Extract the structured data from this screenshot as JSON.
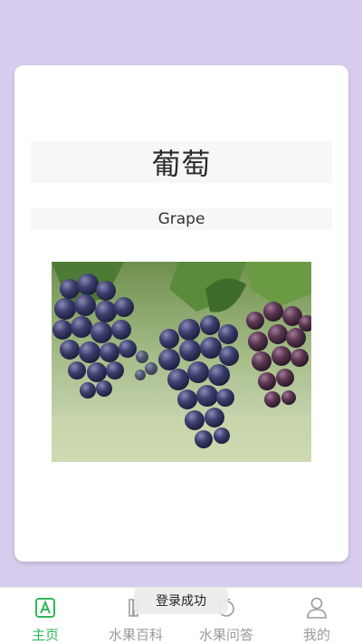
{
  "fruit": {
    "name_cn": "葡萄",
    "name_en": "Grape"
  },
  "tabbar": {
    "tabs": [
      {
        "label": "主页",
        "icon": "home-a-icon",
        "active": true
      },
      {
        "label": "水果百科",
        "icon": "book-icon",
        "active": false
      },
      {
        "label": "水果问答",
        "icon": "apple-icon",
        "active": false
      },
      {
        "label": "我的",
        "icon": "user-icon",
        "active": false
      }
    ]
  },
  "toast": {
    "text": "登录成功"
  },
  "colors": {
    "background": "#d7ccee",
    "active_tab": "#2fb85a",
    "inactive_tab": "#9a9a9a"
  }
}
